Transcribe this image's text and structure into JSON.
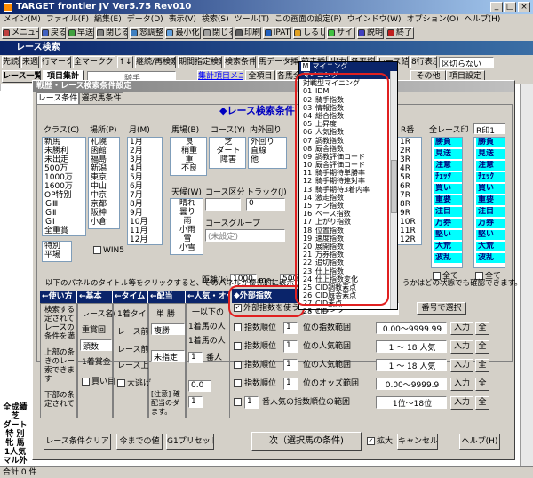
{
  "app": {
    "title": "TARGET frontier JV  Ver5.75  Rev010",
    "menubar": [
      "メイン(M)",
      "ファイル(F)",
      "編集(E)",
      "データ(D)",
      "表示(V)",
      "検索(S)",
      "ツール(T)",
      "この画面の設定(P)",
      "ウインドウ(W)",
      "オプション(O)",
      "ヘルプ(H)"
    ],
    "toolbar": [
      "メニューP",
      "戻る",
      "早送",
      "閉じる",
      "窓調整",
      "最小化",
      "閉じる",
      "印刷",
      "IPAT",
      "しるし",
      "サイト",
      "説明",
      "終了"
    ],
    "race_search_title": "レース検索",
    "race_toolbar": [
      "先読",
      "来週",
      "行マーク",
      "全マーククリア",
      "↑↓",
      "継続/再検索",
      "期間指定検索",
      "検索条件",
      "馬データ挿入",
      "前走挿入",
      "出力",
      "各平均",
      "レース結果",
      "8行表示"
    ],
    "race_toolbar_select": "区切らない",
    "row3": {
      "tab_race_list": "レース一覧",
      "tab_item_total": "項目集計",
      "horse_name": "騎手",
      "menu_label": "集計項目メニュー",
      "all_items": "全項目",
      "horse_all": "各馬全項目",
      "other": "その他",
      "set_items": "項目設定"
    }
  },
  "dialog": {
    "title": "戦歴・レース検索条件設定",
    "tabs": [
      "レース条件",
      "選択馬条件"
    ],
    "header_title": "◆レース検索条件",
    "class_label": "クラス(C)",
    "class_items": [
      "新馬",
      "未勝利",
      "未出走",
      "500万",
      "1000万",
      "1600万",
      "OP特別",
      "ＧⅢ",
      "ＧⅡ",
      "ＧⅠ",
      "全重賞"
    ],
    "class_extra": [
      "特別",
      "平場"
    ],
    "place_label": "場所(P)",
    "place_items": [
      "札幌",
      "函館",
      "福島",
      "新潟",
      "東京",
      "中山",
      "中京",
      "京都",
      "阪神",
      "小倉"
    ],
    "win5_label": "WIN5",
    "month_label": "月(M)",
    "month_items": [
      "1月",
      "2月",
      "3月",
      "4月",
      "5月",
      "6月",
      "7月",
      "8月",
      "9月",
      "10月",
      "11月",
      "12月"
    ],
    "baba_label": "馬場(B)",
    "baba_items": [
      "良",
      "稍重",
      "重",
      "不良"
    ],
    "course_label": "コース(Y)",
    "course_items": [
      "芝",
      "ダート",
      "障害"
    ],
    "inout_label": "内外回り",
    "inout_items": [
      "外回り",
      "直線",
      "他"
    ],
    "weather_label": "天候(W)",
    "weather_items": [
      "晴れ",
      "曇り",
      "雨",
      "小雨",
      "雪",
      "小雪"
    ],
    "course_div_label": "コース区分",
    "track_label": "トラック(J)",
    "track_value": "0",
    "course_group_label": "コースグループ",
    "course_group_value": "(未設定)",
    "distance_label": "距離(k)",
    "distance_from": "1000",
    "distance_sep": "m～",
    "distance_to": "500",
    "r_label": "R番",
    "r_items": [
      "1R",
      "2R",
      "3R",
      "4R",
      "5R",
      "6R",
      "7R",
      "8R",
      "9R",
      "10R",
      "11R",
      "12R"
    ],
    "all_race_label": "全レース印",
    "mark_items": [
      "勝負",
      "見送",
      "注意",
      "ﾁｪｯｸ",
      "買い",
      "重要",
      "注目",
      "万券",
      "堅い",
      "大荒",
      "波乱"
    ],
    "ri_select": "R印1",
    "all_check": "全て",
    "info_text": "以下のパネルのタイトル等をクリックすると、そのパネルが優先的に表示されます。ま",
    "info_text_right": "うかはどの状態でも確認できます。",
    "panels": [
      "←使い方",
      "←基本",
      "←タイム",
      "←配当",
      "←人気・オッズ"
    ],
    "usage_text": [
      "検索する",
      "定されて",
      "レースの",
      "条件を満"
    ],
    "usage_text2": [
      "上部の条",
      "きのレー",
      "索できます"
    ],
    "usage_text3": [
      "下部の条",
      "定されて"
    ],
    "kihon_items": [
      "レース名(",
      "重賞回",
      "頭数",
      "1着賞金",
      "買い目"
    ],
    "kihon_value": "頭数",
    "time_items": [
      "1着タイ",
      "レース前",
      "レース前",
      "レース上"
    ],
    "time_check": "大逃げ",
    "haito_items": [
      "単  勝",
      "複勝",
      "未指定"
    ],
    "ninki_head": "一以下の",
    "ninki_rows": [
      "1着馬の人",
      "1着馬の人",
      "1着馬の人"
    ],
    "ninki_ban": "番人",
    "ninki_val1": "1",
    "ninki_val2": "0.0",
    "ninki_val3": "1",
    "chui": "[注意] 確",
    "chui2": "配当のダ",
    "chui3": "ます。",
    "left_summary": [
      "全成績",
      "芝",
      "ダート",
      "特  別",
      "牝  馬",
      "1人気",
      "マル外"
    ],
    "buttons": {
      "race_clear": "レース条件クリア",
      "now_value": "今までの値",
      "g1_preset": "G1プリセット",
      "next": "次（選択馬の条件)",
      "enlarge": "拡大",
      "cancel": "キャンセル",
      "help": "ヘルプ(H)"
    }
  },
  "sotobu": {
    "header": "◆外部指数",
    "check_label": "外部指数を使う",
    "select_value": "マイニング",
    "number_select_btn": "番号で選択",
    "rows": [
      {
        "label": "指数順位",
        "val": "1",
        "unit": "位の指数範囲",
        "range": "0.00～9999.99",
        "btn": "入力"
      },
      {
        "label": "指数順位",
        "val": "1",
        "unit": "位の人気範囲",
        "range": "1 ～ 18 人気",
        "btn": "入力"
      },
      {
        "label": "指数順位",
        "val": "1",
        "unit": "位の人気範囲",
        "range": "1 ～ 18 人気",
        "btn": "入力"
      },
      {
        "label": "指数順位",
        "val": "1",
        "unit": "位のオッズ範囲",
        "range": "0.00～9999.9",
        "btn": "入力"
      },
      {
        "label": "",
        "val": "1",
        "unit": "番人気の指数順位の範囲",
        "range": "1位～18位",
        "btn": "入力"
      }
    ],
    "all_btn": "全"
  },
  "dropdown": {
    "header": "マイニング",
    "items": [
      "マイニング",
      "対戦型マイニング",
      "IDM",
      "騎手指数",
      "情報指数",
      "総合指数",
      "上昇度",
      "人気指数",
      "調教指数",
      "厩舎指数",
      "調教評価コード",
      "厩舎評価コード",
      "騎手期待単勝率",
      "騎手期待連対率",
      "騎手期待3着内率",
      "激走指数",
      "テン指数",
      "ペース指数",
      "上がり指数",
      "位置指数",
      "速度指数",
      "展開指数",
      "万券指数",
      "追切指数",
      "仕上指数",
      "仕上指数変化",
      "CID調教素点",
      "CID厩舎素点",
      "CID素点",
      "CID"
    ],
    "numbers": [
      "",
      "",
      "01",
      "02",
      "03",
      "04",
      "05",
      "06",
      "07",
      "08",
      "09",
      "10",
      "11",
      "12",
      "13",
      "14",
      "15",
      "16",
      "17",
      "18",
      "19",
      "20",
      "21",
      "22",
      "23",
      "24",
      "25",
      "26",
      "27",
      "28"
    ]
  },
  "status": "合計 0 件"
}
